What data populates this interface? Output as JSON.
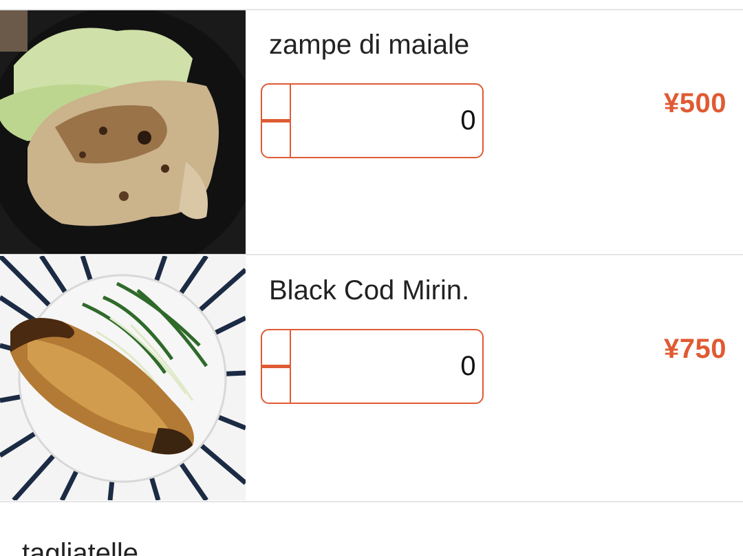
{
  "menu_items": [
    {
      "name": "zampe di maiale",
      "quantity": "0",
      "price": "¥500",
      "image_icon": "pork-trotters-dish-image"
    },
    {
      "name": "Black Cod Mirin.",
      "quantity": "0",
      "price": "¥750",
      "image_icon": "black-cod-dish-image"
    },
    {
      "name": "tagliatelle"
    }
  ],
  "colors": {
    "accent": "#e05a33",
    "divider": "#e4e4e4",
    "text": "#222222"
  }
}
